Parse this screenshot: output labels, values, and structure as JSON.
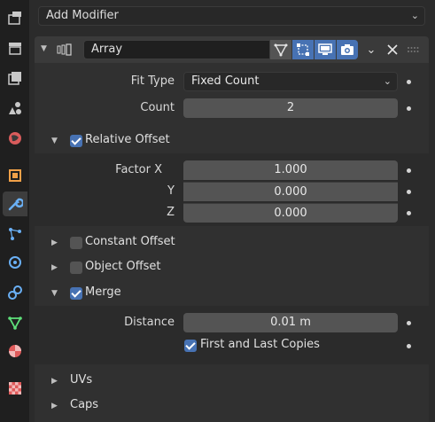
{
  "sidebar": {
    "tabs": [
      {
        "name": "tool-icon",
        "color": "#c8c8c8"
      },
      {
        "name": "render-icon",
        "color": "#c8c8c8"
      },
      {
        "name": "output-icon",
        "color": "#c8c8c8"
      },
      {
        "name": "view-layer-icon",
        "color": "#c8c8c8"
      },
      {
        "name": "scene-icon",
        "color": "#d95c5c"
      },
      {
        "name": "object-icon",
        "color": "#f0a048"
      },
      {
        "name": "modifier-wrench-icon",
        "color": "#6ab0f5",
        "active": true
      },
      {
        "name": "particles-icon",
        "color": "#6ab0f5"
      },
      {
        "name": "physics-icon",
        "color": "#6ab0f5"
      },
      {
        "name": "constraints-icon",
        "color": "#6ab0f5"
      },
      {
        "name": "data-icon",
        "color": "#5ee07a"
      },
      {
        "name": "material-icon",
        "color": "#e05a5a"
      },
      {
        "name": "texture-icon",
        "color": "#e05a5a"
      }
    ]
  },
  "add_modifier": {
    "label": "Add Modifier"
  },
  "modifier": {
    "name": "Array",
    "fit_type": {
      "label": "Fit Type",
      "value": "Fixed Count"
    },
    "count": {
      "label": "Count",
      "value": "2"
    },
    "relative_offset": {
      "label": "Relative Offset",
      "checked": true,
      "factor_x_label": "Factor X",
      "factor_x": "1.000",
      "y_label": "Y",
      "y": "0.000",
      "z_label": "Z",
      "z": "0.000"
    },
    "constant_offset": {
      "label": "Constant Offset",
      "checked": false
    },
    "object_offset": {
      "label": "Object Offset",
      "checked": false
    },
    "merge": {
      "label": "Merge",
      "checked": true,
      "distance_label": "Distance",
      "distance": "0.01 m",
      "first_last_label": "First and Last Copies",
      "first_last_checked": true
    },
    "uvs": {
      "label": "UVs"
    },
    "caps": {
      "label": "Caps"
    }
  },
  "colors": {
    "accent": "#4772b3",
    "panel": "#303030",
    "field": "#545454"
  }
}
